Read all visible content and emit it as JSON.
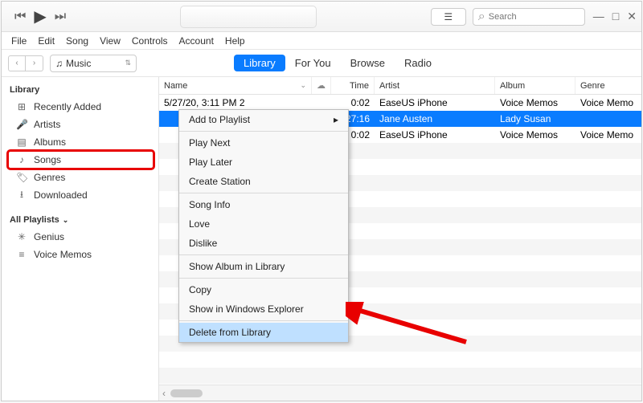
{
  "window": {
    "minimize": "—",
    "maximize": "□",
    "close": "✕"
  },
  "search": {
    "placeholder": "Search"
  },
  "menus": [
    "File",
    "Edit",
    "Song",
    "View",
    "Controls",
    "Account",
    "Help"
  ],
  "source_selector": "Music",
  "tabs": [
    {
      "label": "Library",
      "active": true
    },
    {
      "label": "For You",
      "active": false
    },
    {
      "label": "Browse",
      "active": false
    },
    {
      "label": "Radio",
      "active": false
    }
  ],
  "sidebar": {
    "library_label": "Library",
    "library_items": [
      {
        "icon": "⊞",
        "label": "Recently Added"
      },
      {
        "icon": "🎤",
        "label": "Artists"
      },
      {
        "icon": "▤",
        "label": "Albums"
      },
      {
        "icon": "♪",
        "label": "Songs",
        "highlight": true
      },
      {
        "icon": "🏷",
        "label": "Genres"
      },
      {
        "icon": "⭳",
        "label": "Downloaded"
      }
    ],
    "playlists_label": "All Playlists",
    "playlist_items": [
      {
        "icon": "✳",
        "label": "Genius"
      },
      {
        "icon": "≡",
        "label": "Voice Memos"
      }
    ]
  },
  "columns": {
    "name": "Name",
    "time": "Time",
    "artist": "Artist",
    "album": "Album",
    "genre": "Genre"
  },
  "rows": [
    {
      "name": "5/27/20, 3:11 PM 2",
      "time": "0:02",
      "artist": "EaseUS iPhone",
      "album": "Voice Memos",
      "genre": "Voice Memo",
      "selected": false
    },
    {
      "name": "",
      "time": "27:16",
      "artist": "Jane Austen",
      "album": "Lady Susan",
      "genre": "",
      "selected": true
    },
    {
      "name": "",
      "time": "0:02",
      "artist": "EaseUS iPhone",
      "album": "Voice Memos",
      "genre": "Voice Memo",
      "selected": false
    }
  ],
  "context_menu": {
    "groups": [
      [
        {
          "label": "Add to Playlist",
          "submenu": true
        }
      ],
      [
        {
          "label": "Play Next"
        },
        {
          "label": "Play Later"
        },
        {
          "label": "Create Station"
        }
      ],
      [
        {
          "label": "Song Info"
        },
        {
          "label": "Love"
        },
        {
          "label": "Dislike"
        }
      ],
      [
        {
          "label": "Show Album in Library"
        }
      ],
      [
        {
          "label": "Copy"
        },
        {
          "label": "Show in Windows Explorer"
        }
      ],
      [
        {
          "label": "Delete from Library",
          "hover": true
        }
      ]
    ]
  }
}
